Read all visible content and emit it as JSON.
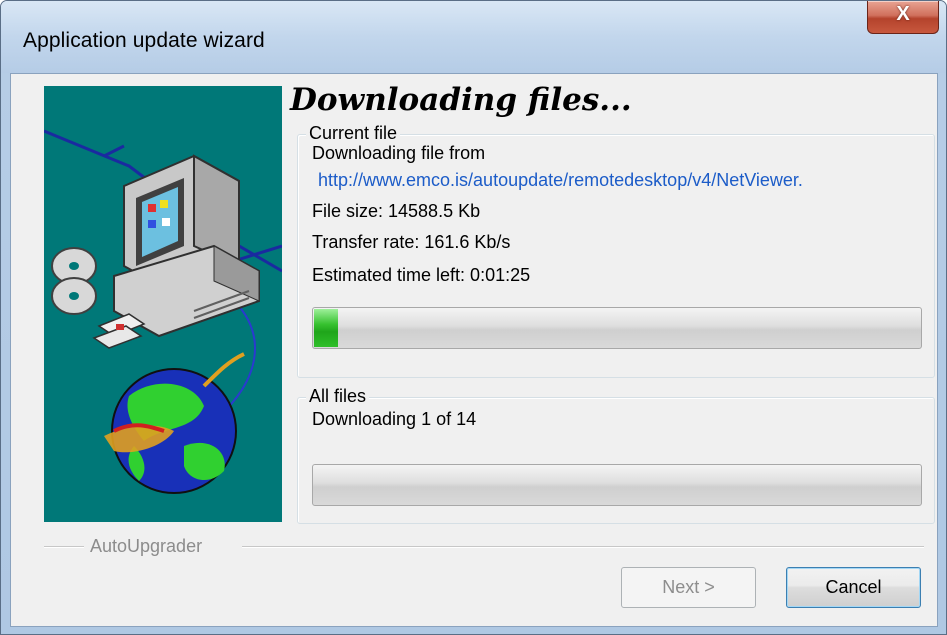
{
  "window": {
    "title": "Application update wizard",
    "close_symbol": "X"
  },
  "heading": "Downloading files...",
  "current_file": {
    "legend": "Current file",
    "downloading_from": "Downloading file from",
    "url": "http://www.emco.is/autoupdate/remotedesktop/v4/NetViewer.",
    "file_size": "File size: 14588.5 Kb",
    "transfer_rate": "Transfer rate: 161.6 Kb/s",
    "time_left": "Estimated time left: 0:01:25",
    "progress_percent": 4
  },
  "all_files": {
    "legend": "All files",
    "status": "Downloading 1 of 14",
    "progress_percent": 0
  },
  "branding": "AutoUpgrader",
  "buttons": {
    "next": "Next >",
    "cancel": "Cancel"
  },
  "colors": {
    "illustration_bg": "#007878",
    "link": "#1c5cc8",
    "progress_green": "#2fbf2a"
  },
  "icons": {
    "illustration": "computer-network-globe-illustration"
  }
}
